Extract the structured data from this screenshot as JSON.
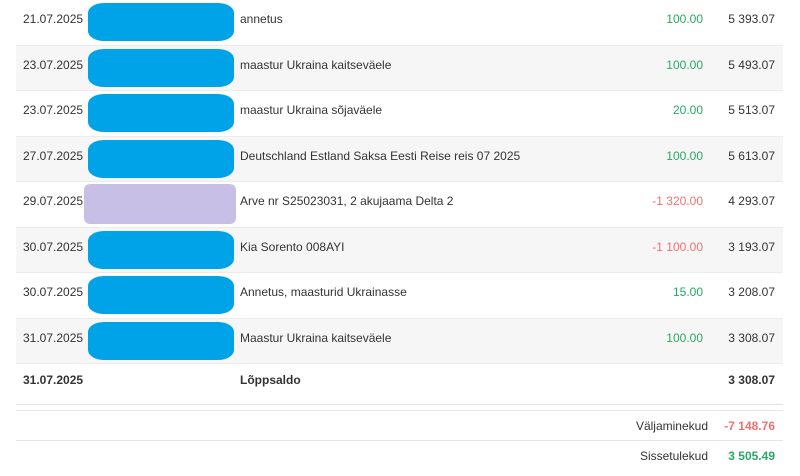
{
  "transactions": [
    {
      "date": "21.07.2025",
      "description": "annetus",
      "amount": "100.00",
      "balance": "5 393.07"
    },
    {
      "date": "23.07.2025",
      "description": "maastur Ukraina kaitseväele",
      "amount": "100.00",
      "balance": "5 493.07"
    },
    {
      "date": "23.07.2025",
      "description": "maastur Ukraina sõjaväele",
      "amount": "20.00",
      "balance": "5 513.07"
    },
    {
      "date": "27.07.2025",
      "description": "Deutschland Estland Saksa Eesti Reise reis 07 2025",
      "amount": "100.00",
      "balance": "5 613.07"
    },
    {
      "date": "29.07.2025",
      "description": "Arve nr S25023031, 2 akujaama Delta 2",
      "amount": "-1 320.00",
      "balance": "4 293.07"
    },
    {
      "date": "30.07.2025",
      "description": "Kia Sorento 008AYI",
      "amount": "-1 100.00",
      "balance": "3 193.07"
    },
    {
      "date": "30.07.2025",
      "description": "Annetus, maasturid Ukrainasse",
      "amount": "15.00",
      "balance": "3 208.07"
    },
    {
      "date": "31.07.2025",
      "description": "Maastur Ukraina kaitseväele",
      "amount": "100.00",
      "balance": "3 308.07"
    }
  ],
  "closing": {
    "date": "31.07.2025",
    "label": "Lõppsaldo",
    "balance": "3 308.07"
  },
  "summary": {
    "outgoing_label": "Väljaminekud",
    "outgoing_value": "-7 148.76",
    "incoming_label": "Sissetulekud",
    "incoming_value": "3 505.49"
  },
  "colors": {
    "positive": "#2aa866",
    "negative": "#f07070",
    "redaction_blue": "#00a3e8",
    "redaction_purple": "#c7bfe6"
  }
}
